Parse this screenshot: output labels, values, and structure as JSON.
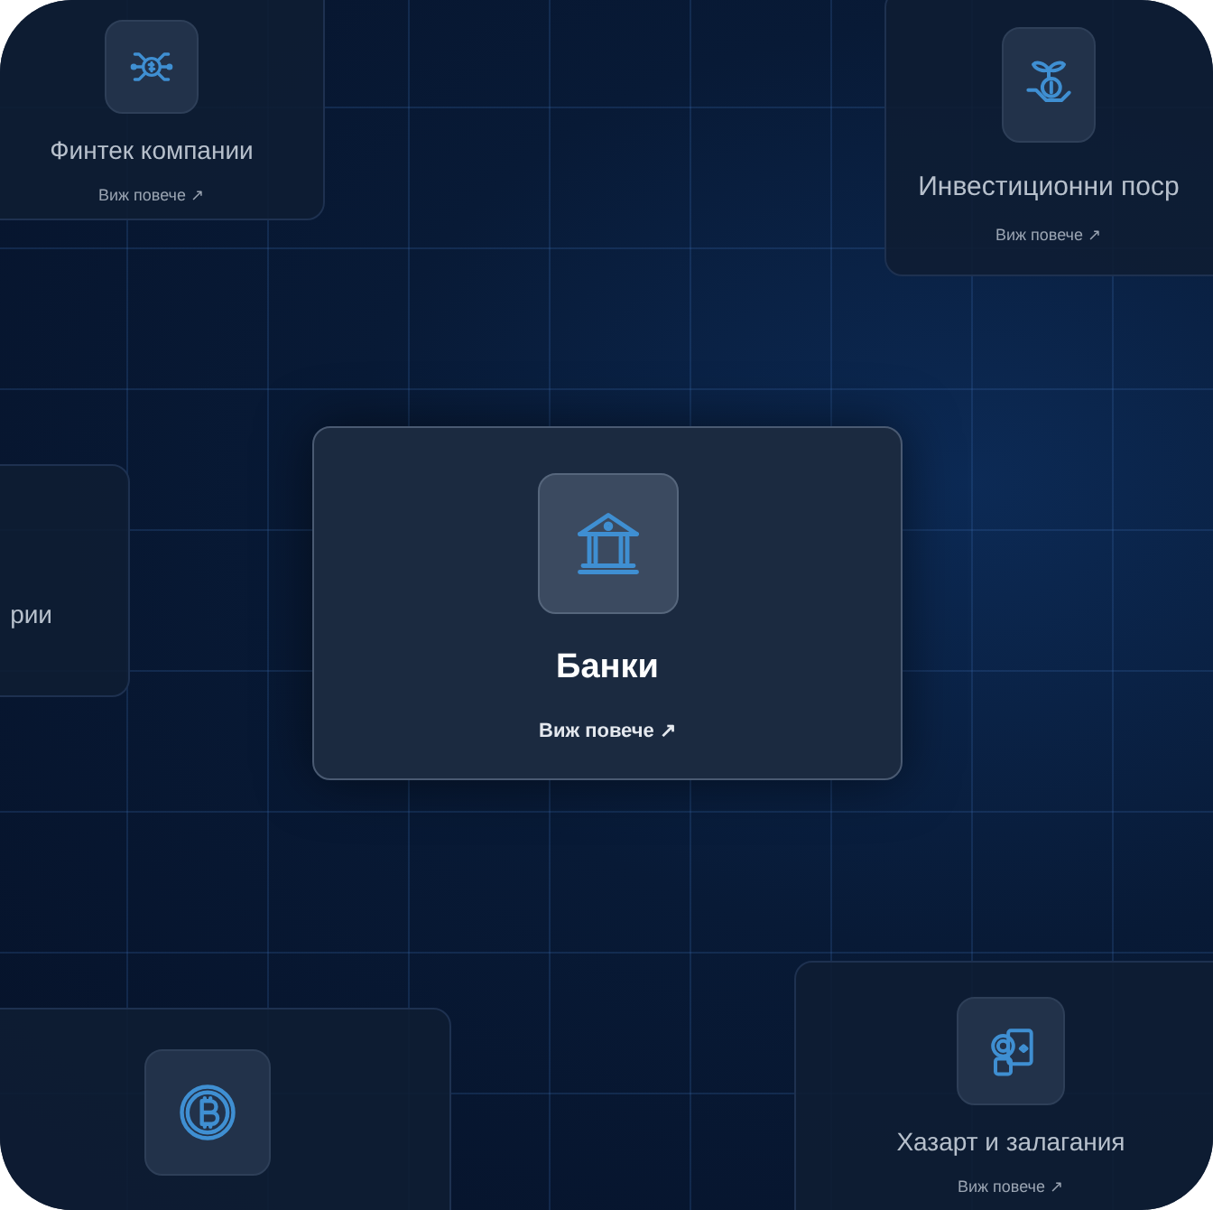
{
  "cards": [
    {
      "kind": "fintech",
      "featured": false,
      "title": "Финтек компании",
      "link": "Виж повече ↗"
    },
    {
      "kind": "investment",
      "featured": false,
      "title": "Инвестиционни поср",
      "link": "Виж повече ↗"
    },
    {
      "kind": "none",
      "featured": false,
      "title": "рии"
    },
    {
      "kind": "bank",
      "featured": true,
      "title": "Банки",
      "link": "Виж повече ↗"
    },
    {
      "kind": "bitcoin",
      "featured": false
    },
    {
      "kind": "gambling",
      "featured": false,
      "title": "Хазарт и залагания",
      "link": "Виж повече ↗"
    }
  ]
}
